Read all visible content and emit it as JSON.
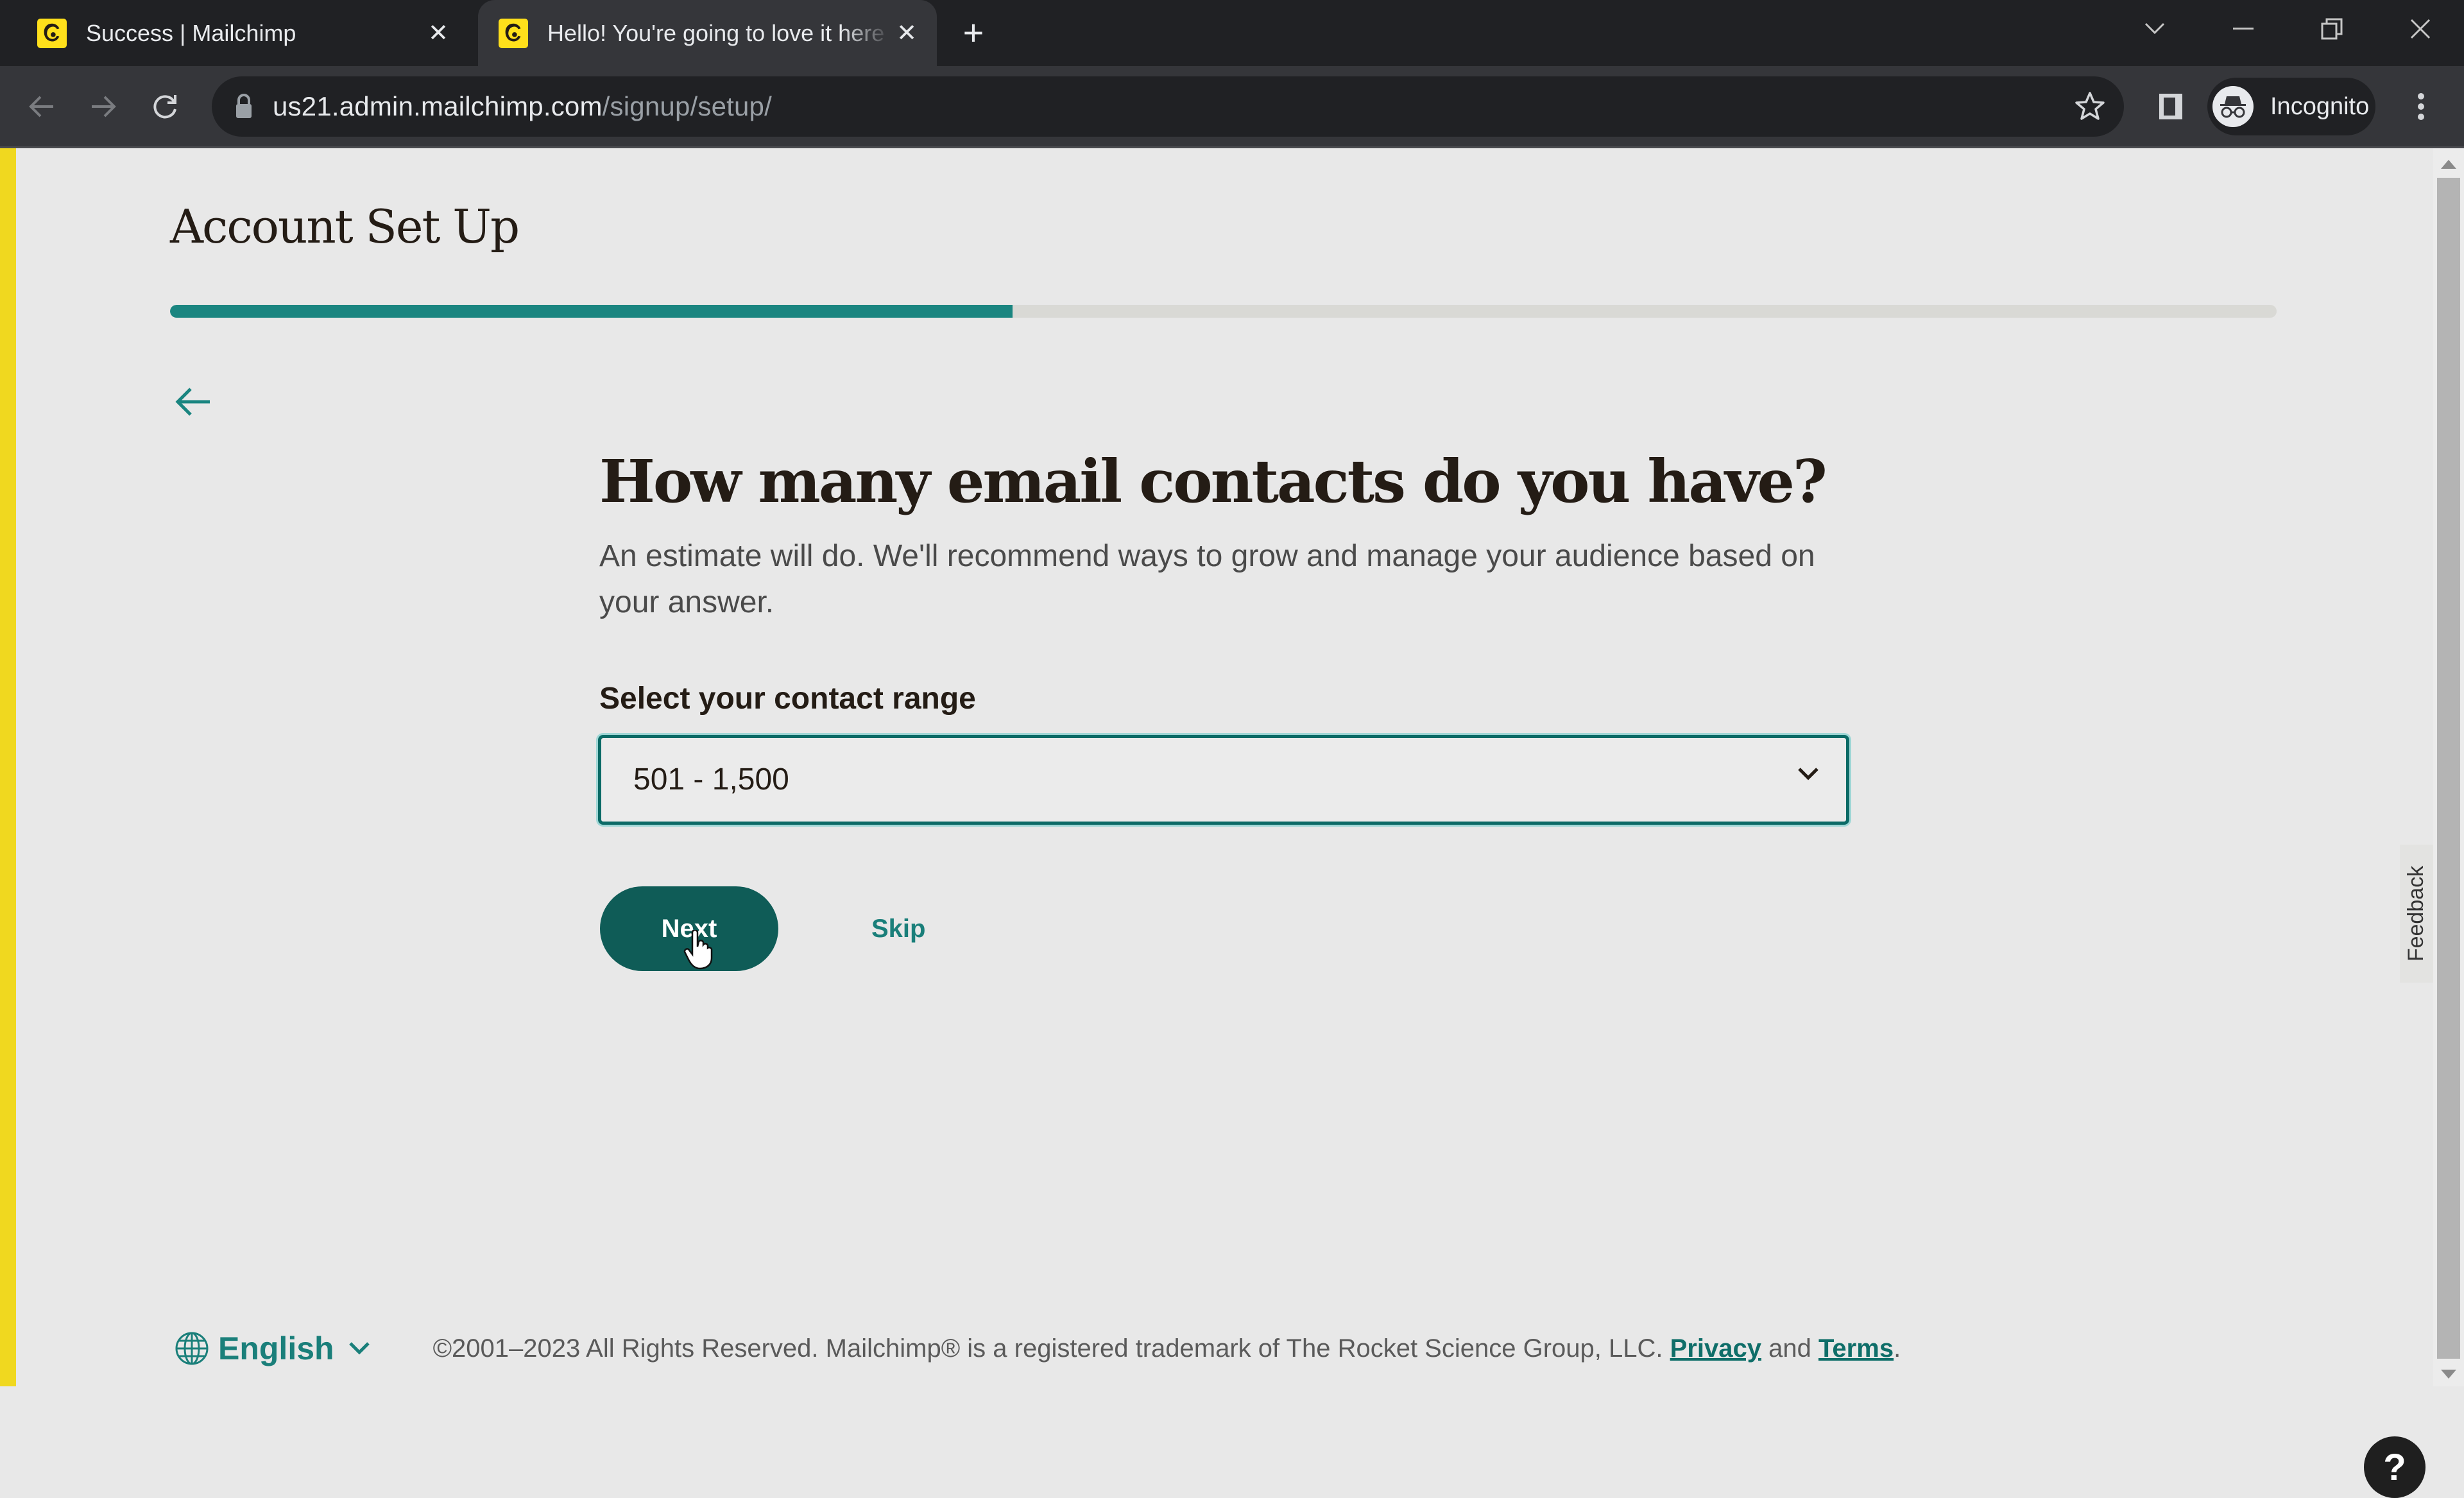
{
  "browser": {
    "tabs": [
      {
        "title": "Success | Mailchimp",
        "active": false
      },
      {
        "title": "Hello! You're going to love it here",
        "active": true
      }
    ],
    "new_tab_label": "+",
    "url_host": "us21.admin.mailchimp.com",
    "url_path": "/signup/setup/",
    "profile_label": "Incognito",
    "icons": {
      "favicon": "mailchimp-logo-icon",
      "tab_close": "close-icon",
      "back": "arrow-left-icon",
      "forward": "arrow-right-icon",
      "reload": "reload-icon",
      "lock": "lock-icon",
      "bookmark": "star-icon",
      "side_panel": "side-panel-icon",
      "incognito": "incognito-icon",
      "menu": "kebab-menu-icon"
    }
  },
  "page": {
    "title": "Account Set Up",
    "progress": {
      "value": 0.4
    },
    "back_icon": "arrow-left-icon",
    "question": "How many email contacts do you have?",
    "description": "An estimate will do. We'll recommend ways to grow and manage your audience based on your answer.",
    "field_label": "Select your contact range",
    "select_value": "501 - 1,500",
    "next_label": "Next",
    "skip_label": "Skip"
  },
  "footer": {
    "language": "English",
    "copyright": "©2001–2023 All Rights Reserved. Mailchimp® is a registered trademark of The Rocket Science Group, LLC.",
    "privacy_label": "Privacy",
    "and_text": "and",
    "terms_label": "Terms",
    "period": "."
  },
  "side": {
    "feedback_label": "Feedback",
    "help_label": "?"
  },
  "colors": {
    "accent": "#1a8580",
    "button": "#0f5c57",
    "brand_yellow": "#ffe01b"
  }
}
